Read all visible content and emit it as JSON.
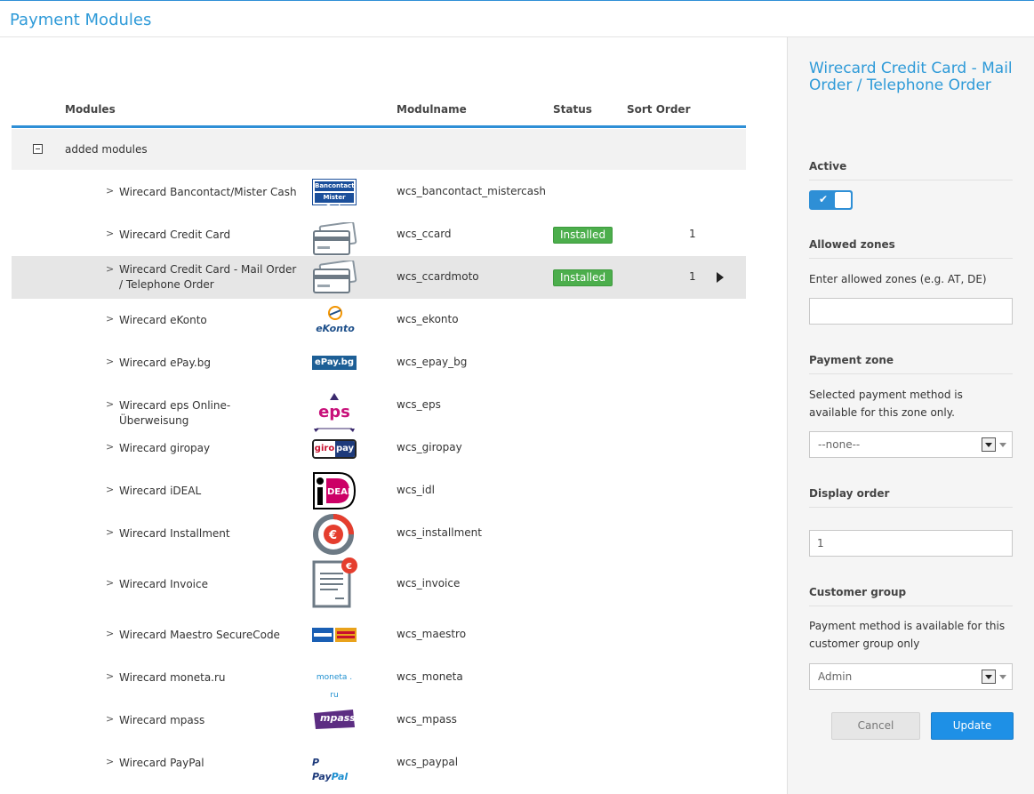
{
  "header": {
    "title": "Payment Modules"
  },
  "table": {
    "columns": {
      "modules": "Modules",
      "modulname": "Modulname",
      "status": "Status",
      "sort_order": "Sort Order"
    },
    "group_label": "added modules",
    "rows": [
      {
        "name": "Wirecard Bancontact/Mister Cash",
        "code": "wcs_bancontact_mistercash",
        "status": "",
        "sort": "",
        "logo": "bancontact-logo",
        "logo_text": [
          "Bancontact",
          "Mister Cash"
        ]
      },
      {
        "name": "Wirecard Credit Card",
        "code": "wcs_ccard",
        "status": "Installed",
        "sort": "1",
        "logo": "credit-card-logo"
      },
      {
        "name": "Wirecard Credit Card - Mail Order / Telephone Order",
        "code": "wcs_ccardmoto",
        "status": "Installed",
        "sort": "1",
        "logo": "credit-card-logo",
        "selected": true
      },
      {
        "name": "Wirecard eKonto",
        "code": "wcs_ekonto",
        "status": "",
        "sort": "",
        "logo": "ekonto-logo",
        "logo_text": "eKonto"
      },
      {
        "name": "Wirecard ePay.bg",
        "code": "wcs_epay_bg",
        "status": "",
        "sort": "",
        "logo": "epay-logo",
        "logo_text": "ePay.bg"
      },
      {
        "name": "Wirecard eps Online-Überweisung",
        "code": "wcs_eps",
        "status": "",
        "sort": "",
        "logo": "eps-logo",
        "logo_text": "eps"
      },
      {
        "name": "Wirecard giropay",
        "code": "wcs_giropay",
        "status": "",
        "sort": "",
        "logo": "giropay-logo",
        "logo_text": [
          "giro",
          "pay"
        ]
      },
      {
        "name": "Wirecard iDEAL",
        "code": "wcs_idl",
        "status": "",
        "sort": "",
        "logo": "ideal-logo",
        "logo_text": "iDEAL"
      },
      {
        "name": "Wirecard Installment",
        "code": "wcs_installment",
        "status": "",
        "sort": "",
        "logo": "installment-logo"
      },
      {
        "name": "Wirecard Invoice",
        "code": "wcs_invoice",
        "status": "",
        "sort": "",
        "logo": "invoice-logo"
      },
      {
        "name": "Wirecard Maestro SecureCode",
        "code": "wcs_maestro",
        "status": "",
        "sort": "",
        "logo": "maestro-logo"
      },
      {
        "name": "Wirecard moneta.ru",
        "code": "wcs_moneta",
        "status": "",
        "sort": "",
        "logo": "moneta-logo",
        "logo_text": "moneta . ru"
      },
      {
        "name": "Wirecard mpass",
        "code": "wcs_mpass",
        "status": "",
        "sort": "",
        "logo": "mpass-logo",
        "logo_text": "mpass"
      },
      {
        "name": "Wirecard PayPal",
        "code": "wcs_paypal",
        "status": "",
        "sort": "",
        "logo": "paypal-logo",
        "logo_text": [
          "Pay",
          "Pal"
        ]
      }
    ]
  },
  "side": {
    "title": "Wirecard Credit Card - Mail Order / Telephone Order",
    "active_label": "Active",
    "active": true,
    "allowed_zones_label": "Allowed zones",
    "allowed_zones_help": "Enter allowed zones (e.g. AT, DE)",
    "allowed_zones_value": "",
    "payment_zone_label": "Payment zone",
    "payment_zone_help": "Selected payment method is available for this zone only.",
    "payment_zone_value": "--none--",
    "display_order_label": "Display order",
    "display_order_value": "1",
    "customer_group_label": "Customer group",
    "customer_group_help": "Payment method is available for this customer group only",
    "customer_group_value": "Admin",
    "cancel_label": "Cancel",
    "update_label": "Update"
  },
  "colors": {
    "accent": "#2e9ad8",
    "installed": "#4cae4c",
    "update_button": "#1e90e6"
  }
}
